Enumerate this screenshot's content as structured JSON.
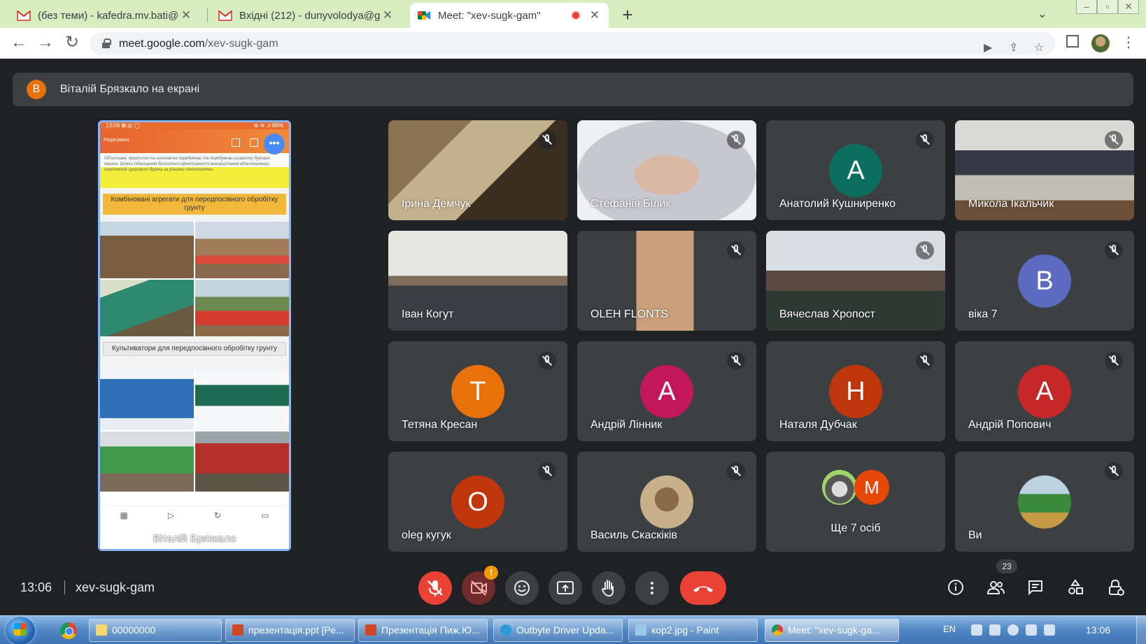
{
  "browser": {
    "tabs": [
      {
        "title": "(без теми) - kafedra.mv.bati@gma",
        "favicon": "gmail-icon"
      },
      {
        "title": "Вхідні (212) - dunyvolodya@gma",
        "favicon": "gmail-icon"
      },
      {
        "title": "Meet: \"xev-sugk-gam\"",
        "favicon": "meet-icon",
        "recording": true
      }
    ],
    "url_host": "meet.google.com",
    "url_path": "/xev-sugk-gam"
  },
  "meet": {
    "banner_initial": "В",
    "banner_text": "Віталій Брязкало на екрані",
    "presentation": {
      "status_left": "13:06 ⊠ ◎ ◯",
      "status_right": "⊛ ≋ .ıl 66%",
      "toolbar_label": "Редагувати",
      "more_label": "•••",
      "slide_text": "Об'єктивні, практичні та економічні передумови та передумови розвитку бурових машин. Шляхи підвищення біологічної ефективності використання вдосконалених комплектів цукрового буряка за різними технологіями",
      "heading1": "Комбіновані агрегати для передпосівного обробітку грунту",
      "heading2": "Культиватори для передпосівного обробітку грунту",
      "presenter_name": "Віталій Брязкало"
    },
    "participants": [
      {
        "name": "Ірина Демчук",
        "type": "video",
        "muted": true
      },
      {
        "name": "Стефанія Білик",
        "type": "video",
        "muted": true
      },
      {
        "name": "Анатолий Кушниренко",
        "type": "avatar",
        "initial": "A",
        "color": "#0b6e5f",
        "muted": true
      },
      {
        "name": "Микола Ікальчик",
        "type": "video",
        "muted": true
      },
      {
        "name": "Іван Когут",
        "type": "video",
        "muted": false
      },
      {
        "name": "OLEH FLONTS",
        "type": "video",
        "muted": true
      },
      {
        "name": "Вячеслав Хропост",
        "type": "video",
        "muted": true
      },
      {
        "name": "віка 7",
        "type": "avatar",
        "initial": "В",
        "color": "#5c6bc0",
        "muted": true
      },
      {
        "name": "Тетяна Кресан",
        "type": "avatar",
        "initial": "T",
        "color": "#e8710a",
        "muted": true
      },
      {
        "name": "Андрій Лінник",
        "type": "avatar",
        "initial": "A",
        "color": "#c2185b",
        "muted": true
      },
      {
        "name": "Наталя Дубчак",
        "type": "avatar",
        "initial": "H",
        "color": "#bf360c",
        "muted": true
      },
      {
        "name": "Андрій Попович",
        "type": "avatar",
        "initial": "A",
        "color": "#c62828",
        "muted": true
      },
      {
        "name": "oleg кугук",
        "type": "avatar",
        "initial": "O",
        "color": "#bf360c",
        "muted": true
      },
      {
        "name": "Василь Скаскіків",
        "type": "photo-avatar",
        "muted": true
      },
      {
        "name": "Ще 7 осіб",
        "type": "group",
        "initial": "M",
        "color": "#e8470a",
        "muted": false
      },
      {
        "name": "Ви",
        "type": "photo-avatar",
        "muted": true
      }
    ],
    "meeting_time": "13:06",
    "meeting_code": "xev-sugk-gam",
    "people_count": "23",
    "warning_badge": "!"
  },
  "taskbar": {
    "items": [
      {
        "label": "00000000"
      },
      {
        "label": "презентація.ppt [Ре..."
      },
      {
        "label": "Презентація Пиж.Ю..."
      },
      {
        "label": "Outbyte Driver Upda..."
      },
      {
        "label": "кор2.jpg - Paint"
      },
      {
        "label": "Meet: \"xev-sugk-ga..."
      }
    ],
    "language": "EN",
    "clock": "13:06"
  },
  "colors": {
    "meet_bg": "#202124",
    "tile_bg": "#3c4043",
    "danger": "#ea4335",
    "present_border": "#8ab4f8",
    "tabbar_bg": "#d7ecbf"
  }
}
